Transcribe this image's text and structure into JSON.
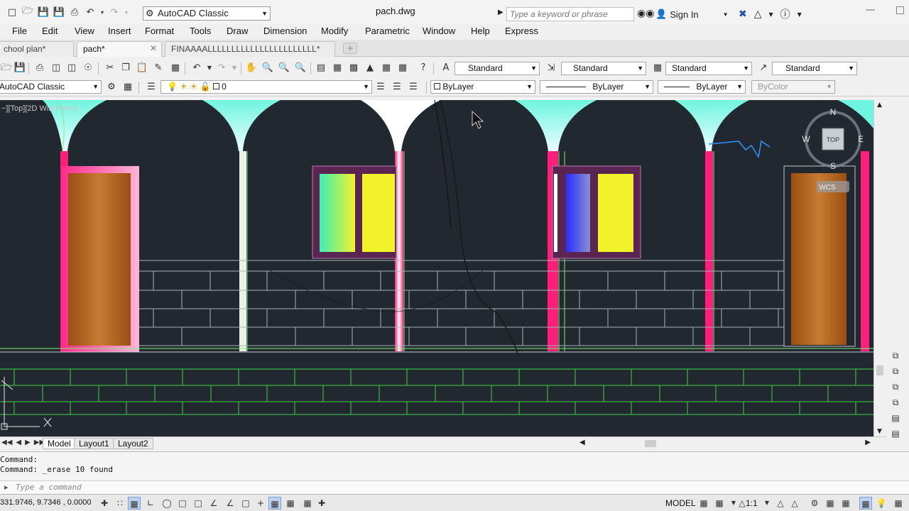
{
  "title_bar": {
    "workspace": "AutoCAD Classic",
    "document_title": "pach.dwg",
    "search_placeholder": "Type a keyword or phrase",
    "sign_in": "Sign In"
  },
  "menu": [
    "File",
    "Edit",
    "View",
    "Insert",
    "Format",
    "Tools",
    "Draw",
    "Dimension",
    "Modify",
    "Parametric",
    "Window",
    "Help",
    "Express"
  ],
  "tabs": [
    {
      "label": "chool plan*",
      "active": false
    },
    {
      "label": "pach*",
      "active": true
    },
    {
      "label": "FINAAAALLLLLLLLLLLLLLLLLLLLLLL*",
      "active": false
    }
  ],
  "toolbar1": {
    "text_style": "Standard",
    "dim_style": "Standard",
    "table_style": "Standard",
    "mleader_style": "Standard"
  },
  "toolbar2": {
    "workspace": "AutoCAD Classic",
    "layer": "0",
    "color": "ByLayer",
    "linetype": "ByLayer",
    "lineweight": "ByLayer",
    "plot_style": "ByColor"
  },
  "viewport": {
    "label": "−][Top][2D Wireframe]",
    "viewcube": {
      "top": "TOP",
      "north": "N",
      "south": "S",
      "east": "E",
      "west": "W",
      "wcs": "WCS"
    }
  },
  "layout_tabs": [
    "Model",
    "Layout1",
    "Layout2"
  ],
  "command_history": [
    "Command:",
    "Command: _erase 10 found"
  ],
  "command_placeholder": "Type a command",
  "status": {
    "coords": "331.9746, 9.7346 , 0.0000",
    "model": "MODEL",
    "scale": "1:1"
  }
}
